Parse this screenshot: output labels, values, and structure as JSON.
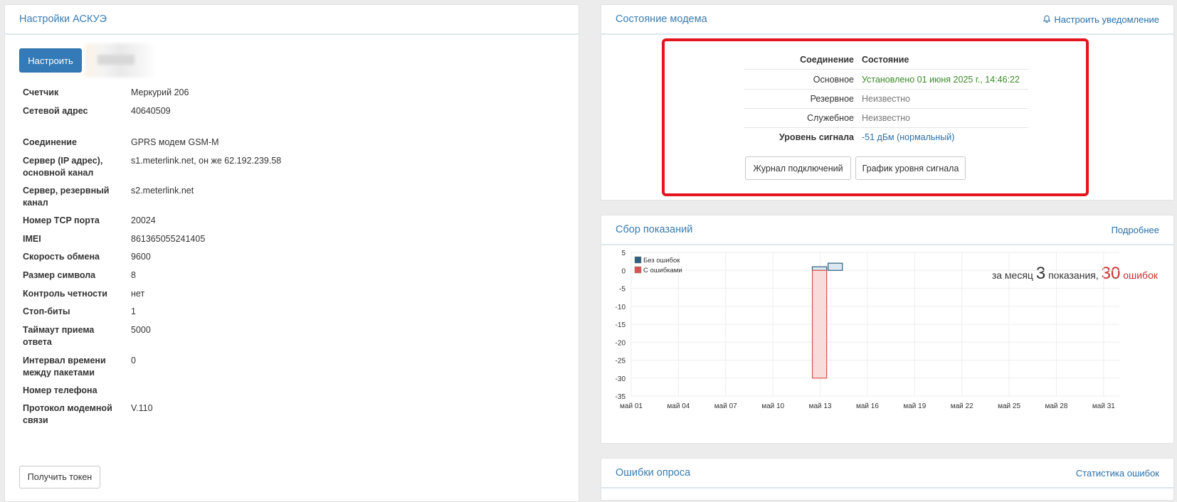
{
  "askue": {
    "title": "Настройки АСКУЭ",
    "configure_button": "Настроить",
    "rows": [
      {
        "key": "Счетчик",
        "value": "Меркурий 206"
      },
      {
        "key": "Сетевой адрес",
        "value": "40640509"
      },
      {
        "key": "Соединение",
        "value": "GPRS модем GSM-M"
      },
      {
        "key": "Сервер (IP адрес), основной канал",
        "value": "s1.meterlink.net, он же 62.192.239.58"
      },
      {
        "key": "Сервер, резервный канал",
        "value": "s2.meterlink.net"
      },
      {
        "key": "Номер TCP порта",
        "value": "20024"
      },
      {
        "key": "IMEI",
        "value": "861365055241405"
      },
      {
        "key": "Скорость обмена",
        "value": "9600"
      },
      {
        "key": "Размер символа",
        "value": "8"
      },
      {
        "key": "Контроль четности",
        "value": "нет"
      },
      {
        "key": "Стоп-биты",
        "value": "1"
      },
      {
        "key": "Таймаут приема ответа",
        "value": "5000"
      },
      {
        "key": "Интервал времени между пакетами",
        "value": "0"
      },
      {
        "key": "Номер телефона",
        "value": ""
      },
      {
        "key": "Протокол модемной связи",
        "value": "V.110"
      }
    ],
    "token_button": "Получить токен"
  },
  "modem": {
    "title": "Состояние модема",
    "notify_link": "Настроить уведомление",
    "header_conn": "Соединение",
    "header_state": "Состояние",
    "rows": [
      {
        "key": "Основное",
        "value": "Установлено 01 июня 2025 г., 14:46:22",
        "status": "ok"
      },
      {
        "key": "Резервное",
        "value": "Неизвестно",
        "status": "unknown"
      },
      {
        "key": "Служебное",
        "value": "Неизвестно",
        "status": "unknown"
      }
    ],
    "signal_label": "Уровень сигнала",
    "signal_value": "-51 дБм (нормальный)",
    "log_button": "Журнал подключений",
    "signal_chart_button": "График уровня сигнала",
    "colors": {
      "ok": "#3c8a2a",
      "unknown": "#777777",
      "highlight": "#e3141c"
    }
  },
  "readings": {
    "title": "Сбор показаний",
    "more_link": "Подробнее",
    "summary": {
      "prefix": "за месяц",
      "count": "3",
      "count_label": "показания,",
      "errors": "30",
      "errors_label": "ошибок"
    }
  },
  "errors_panel": {
    "title": "Ошибки опроса",
    "stats_link": "Статистика ошибок"
  },
  "chart_data": {
    "type": "bar",
    "x_tick_labels": [
      "май 01",
      "май 04",
      "май 07",
      "май 10",
      "май 13",
      "май 16",
      "май 19",
      "май 22",
      "май 25",
      "май 28",
      "май 31"
    ],
    "x_tick_days": [
      1,
      4,
      7,
      10,
      13,
      16,
      19,
      22,
      25,
      28,
      31
    ],
    "xlim": [
      1,
      32
    ],
    "ylim": [
      -35,
      5
    ],
    "y_ticks": [
      5,
      0,
      -5,
      -10,
      -15,
      -20,
      -25,
      -30,
      -35
    ],
    "grid": true,
    "legend_position": "top-left",
    "series": [
      {
        "name": "Без ошибок",
        "color": "#2f5f7f",
        "fill": "#dbe8f1",
        "points": [
          {
            "day": 13,
            "value": 1
          },
          {
            "day": 14,
            "value": 2
          }
        ]
      },
      {
        "name": "С ошибками",
        "color": "#d9534f",
        "fill": "#f8dcdb",
        "points": [
          {
            "day": 13,
            "value": -30
          }
        ]
      }
    ]
  }
}
